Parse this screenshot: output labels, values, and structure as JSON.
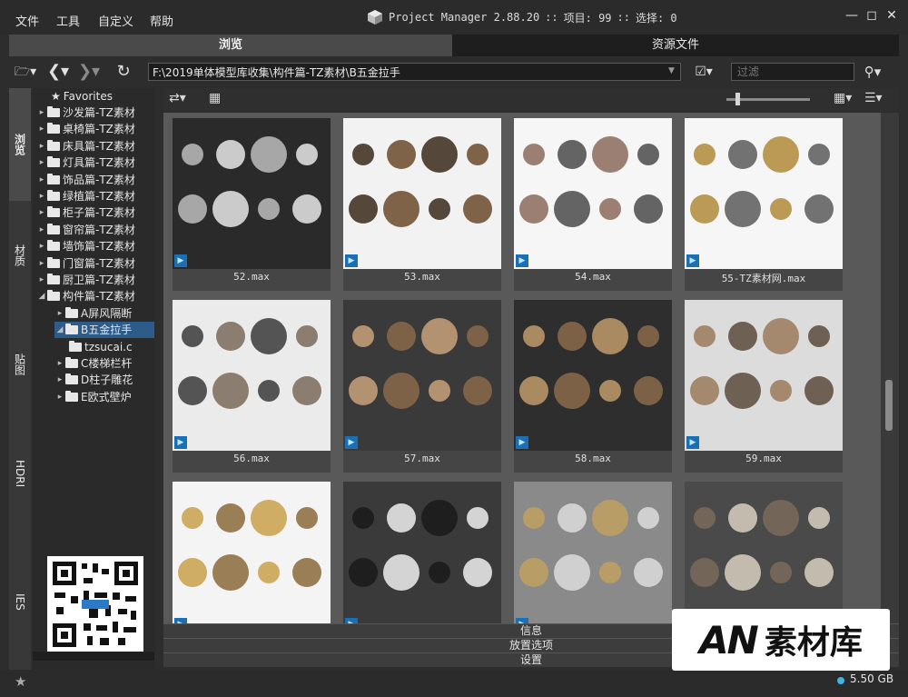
{
  "menu": {
    "file": "文件",
    "tools": "工具",
    "custom": "自定义",
    "help": "帮助"
  },
  "title": {
    "app": "Project Manager 2.88.20",
    "sep1": "::",
    "items_label": "项目: 99",
    "sep2": "::",
    "selected_label": "选择: 0"
  },
  "tabs": {
    "browse": "浏览",
    "assets": "资源文件"
  },
  "address": {
    "path": "F:\\2019单体模型库收集\\构件篇-TZ素材\\B五金拉手",
    "filter_placeholder": "过滤"
  },
  "vtabs": {
    "browse": "浏览",
    "materials": "材质",
    "maps": "贴图",
    "hdri": "HDRI",
    "ies": "IES"
  },
  "tree": {
    "favorites": "Favorites",
    "items": [
      {
        "label": "沙发篇-TZ素材"
      },
      {
        "label": "桌椅篇-TZ素材"
      },
      {
        "label": "床具篇-TZ素材"
      },
      {
        "label": "灯具篇-TZ素材"
      },
      {
        "label": "饰品篇-TZ素材"
      },
      {
        "label": "绿植篇-TZ素材"
      },
      {
        "label": "柜子篇-TZ素材"
      },
      {
        "label": "窗帘篇-TZ素材"
      },
      {
        "label": "墙饰篇-TZ素材"
      },
      {
        "label": "门窗篇-TZ素材"
      },
      {
        "label": "厨卫篇-TZ素材"
      },
      {
        "label": "构件篇-TZ素材"
      }
    ],
    "children": [
      {
        "label": "A屏风隔断"
      },
      {
        "label": "B五金拉手"
      },
      {
        "label": "tzsucai.c"
      },
      {
        "label": "C楼梯栏杆"
      },
      {
        "label": "D柱子雕花"
      },
      {
        "label": "E欧式壁炉"
      }
    ]
  },
  "files": [
    {
      "name": "52.max"
    },
    {
      "name": "53.max"
    },
    {
      "name": "54.max"
    },
    {
      "name": "55-TZ素材网.max"
    },
    {
      "name": "56.max"
    },
    {
      "name": "57.max"
    },
    {
      "name": "58.max"
    },
    {
      "name": "59.max"
    },
    {
      "name": ""
    },
    {
      "name": ""
    },
    {
      "name": ""
    },
    {
      "name": ""
    }
  ],
  "panels": {
    "info": "信息",
    "placement": "放置选项",
    "settings": "设置"
  },
  "status": {
    "disk_free": "5.50 GB"
  },
  "watermark": {
    "logo": "AN",
    "text": "素材库"
  },
  "colors": {
    "accent": "#2e5c8a",
    "max_icon": "#1b6fb5",
    "disk_dot": "#3fb4e6"
  }
}
